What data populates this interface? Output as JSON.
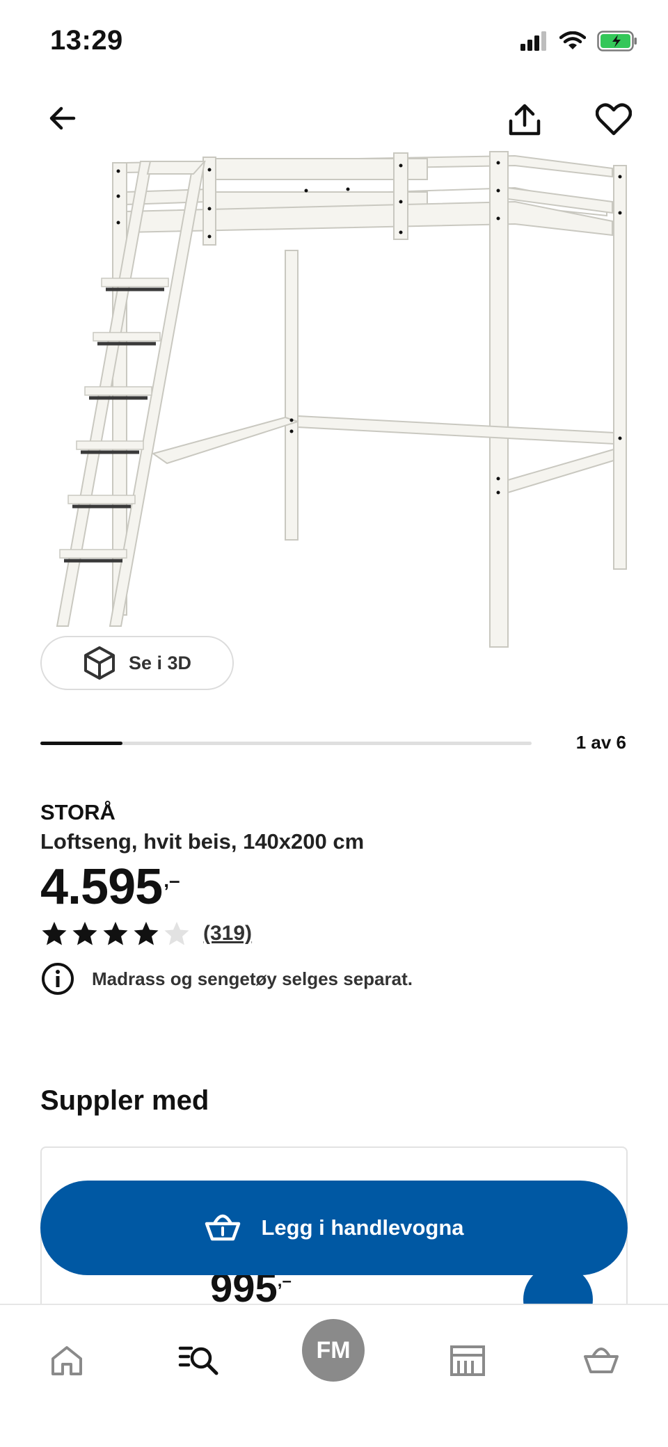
{
  "status_bar": {
    "time": "13:29"
  },
  "gallery": {
    "view_3d_label": "Se i 3D",
    "pager_text": "1 av 6",
    "current_index": 1,
    "total": 6
  },
  "product": {
    "brand": "STORÅ",
    "description": "Loftseng, hvit beis, 140x200 cm",
    "price": "4.595",
    "price_suffix": ",–",
    "rating_value": 4,
    "rating_max": 5,
    "review_count": "(319)",
    "notice": "Madrass og sengetøy selges separat."
  },
  "supplement": {
    "title": "Suppler med",
    "card_price": "995",
    "card_price_suffix": ",–"
  },
  "cart": {
    "button_label": "Legg i handlevogna"
  },
  "nav": {
    "avatar_initials": "FM"
  },
  "colors": {
    "accent": "#0058a3",
    "avatar": "#8a8a8a"
  }
}
